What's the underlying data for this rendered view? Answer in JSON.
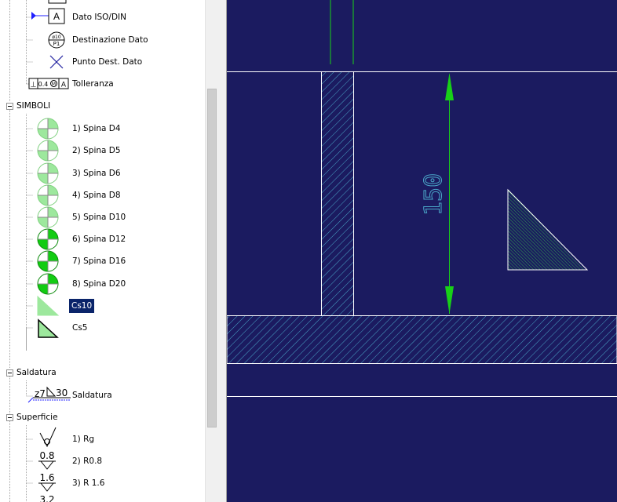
{
  "tree": {
    "top_items": [
      {
        "label": "Dato ISO/DIN",
        "icon": "datum-iso-icon"
      },
      {
        "label": "Destinazione Dato",
        "icon": "datum-target-icon"
      },
      {
        "label": "Punto Dest. Dato",
        "icon": "datum-point-cross-icon"
      },
      {
        "label": "Tolleranza",
        "icon": "tolerance-frame-icon",
        "frame": [
          "⊥",
          "0.4",
          "M",
          "A"
        ]
      }
    ],
    "groups": {
      "simboli": "SIMBOLI",
      "saldatura": "Saldatura",
      "superficie": "Superficie"
    },
    "simboli_items": [
      {
        "label": "1) Spina D4",
        "icon": "pin-quadrant-icon",
        "color": "light"
      },
      {
        "label": "2) Spina D5",
        "icon": "pin-quadrant-icon",
        "color": "light"
      },
      {
        "label": "3) Spina D6",
        "icon": "pin-quadrant-icon",
        "color": "light"
      },
      {
        "label": "4) Spina D8",
        "icon": "pin-quadrant-icon",
        "color": "light"
      },
      {
        "label": "5) Spina D10",
        "icon": "pin-quadrant-icon",
        "color": "light"
      },
      {
        "label": "6) Spina D12",
        "icon": "pin-quadrant-icon",
        "color": "dark"
      },
      {
        "label": "7) Spina D16",
        "icon": "pin-quadrant-icon",
        "color": "dark"
      },
      {
        "label": "8) Spina D20",
        "icon": "pin-quadrant-icon",
        "color": "dark"
      },
      {
        "label": "Cs10",
        "icon": "triangle-icon",
        "selected": true
      },
      {
        "label": "Cs5",
        "icon": "triangle-outlined-icon"
      }
    ],
    "saldatura_items": [
      {
        "label": "Saldatura",
        "icon": "weld-symbol-icon",
        "icon_text": "z7",
        "icon_num": "30"
      }
    ],
    "superficie_items": [
      {
        "label": "1) Rg",
        "icon": "surface-finish-icon",
        "value": ""
      },
      {
        "label": "2) R0.8",
        "icon": "surface-finish-icon",
        "value": "0.8"
      },
      {
        "label": "3) R 1.6",
        "icon": "surface-finish-icon",
        "value": "1.6"
      },
      {
        "label": "",
        "icon": "surface-finish-icon",
        "value": "3.2"
      }
    ]
  },
  "drawing": {
    "dimension_value": "150",
    "colors": {
      "background": "#1b1b60",
      "lines": "#ffffff",
      "hatch": "#4aa6c8",
      "dimension": "#18d018",
      "dimension_text": "#4aa6c8",
      "triangle_hatch": "#2ea64a"
    }
  },
  "colors": {
    "selection": "#0a246a",
    "pin_light": "#9de89d",
    "pin_dark": "#12cc12"
  }
}
